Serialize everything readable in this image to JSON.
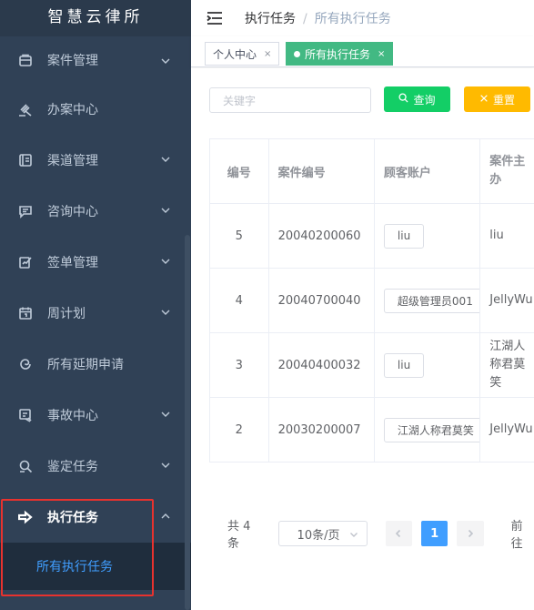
{
  "brand": {
    "title": "智慧云律所"
  },
  "header": {
    "breadcrumb": {
      "parent": "执行任务",
      "separator": "/",
      "current": "所有执行任务"
    }
  },
  "tags": [
    {
      "label": "个人中心",
      "close": "×"
    },
    {
      "label": "所有执行任务",
      "close": "×"
    }
  ],
  "sidebar": {
    "items": [
      {
        "label": "案件管理",
        "icon": "briefcase-icon"
      },
      {
        "label": "办案中心",
        "icon": "gavel-icon"
      },
      {
        "label": "渠道管理",
        "icon": "channel-icon"
      },
      {
        "label": "咨询中心",
        "icon": "message-icon"
      },
      {
        "label": "签单管理",
        "icon": "sign-icon"
      },
      {
        "label": "周计划",
        "icon": "calendar-icon"
      },
      {
        "label": "所有延期申请",
        "icon": "spiral-icon"
      },
      {
        "label": "事故中心",
        "icon": "accident-icon"
      },
      {
        "label": "鉴定任务",
        "icon": "magnifier-icon"
      },
      {
        "label": "执行任务",
        "icon": "arrow-right-icon"
      }
    ],
    "sub_item": "所有执行任务"
  },
  "search": {
    "placeholder": "关键字",
    "query_label": "查询",
    "reset_label": "重置"
  },
  "table": {
    "columns": [
      "编号",
      "案件编号",
      "顾客账户",
      "案件主办"
    ],
    "rows": [
      {
        "id": "5",
        "case_no": "20040200060",
        "account": "liu",
        "party": "liu"
      },
      {
        "id": "4",
        "case_no": "20040700040",
        "account": "超级管理员001",
        "party": "JellyWu"
      },
      {
        "id": "3",
        "case_no": "20040400032",
        "account": "liu",
        "party": "江湖人称君莫笑"
      },
      {
        "id": "2",
        "case_no": "20030200007",
        "account": "江湖人称君莫笑",
        "party": "JellyWu"
      }
    ]
  },
  "pagination": {
    "total": "共 4 条",
    "page_size": "10条/页",
    "current_page": "1",
    "goto": "前往"
  },
  "colors": {
    "sidebar_bg": "#304156",
    "active_link": "#409eff",
    "query_btn": "#13ce66",
    "reset_btn": "#ffba00",
    "active_tag": "#42b983",
    "highlight": "#e8322e"
  }
}
